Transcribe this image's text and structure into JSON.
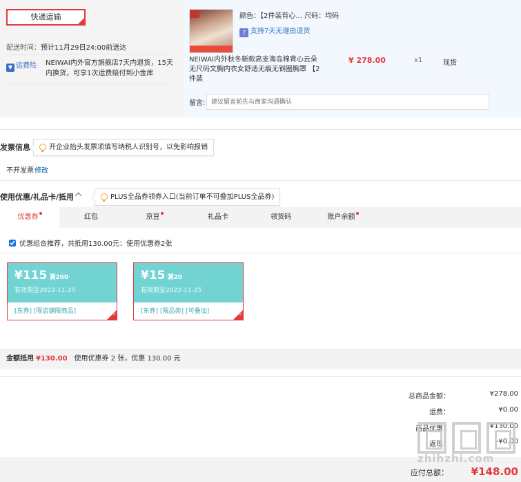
{
  "shipping": {
    "method_label": "快递运输",
    "time_label": "配送时间：",
    "time_value": "预计11月29日24:00前送达",
    "service_tag": "运费险",
    "service_text": "NEIWAI内外官方旗舰店7天内退货，15天内换货，可享1次运费赔付到小金库"
  },
  "product": {
    "attr_text": "颜色：【2件装背心...   尺码：均码",
    "return_text": "支持7天无理由退货",
    "return_icon": "seven-day-icon",
    "name": "NEIWAI内外秋冬新款高支海岛棉背心云朵无尺码文胸内衣女舒适无痕无钢圈胸罩 【2件装",
    "price": "¥ 278.00",
    "qty": "x1",
    "stock": "现货"
  },
  "remark": {
    "label": "留言:",
    "placeholder": "建议留言前先与商家沟通确认"
  },
  "invoice": {
    "title": "发票信息",
    "tip": "开企业抬头发票须填写纳税人识别号，以免影响报销",
    "status": "不开发票",
    "edit_label": "修改"
  },
  "coupons": {
    "title": "使用优惠/礼品卡/抵用",
    "tip": "PLUS全品券领券入口(当前订单不可叠加PLUS全品券)",
    "tabs": [
      {
        "label": "优惠券",
        "active": true
      },
      {
        "label": "红包"
      },
      {
        "label": "京豆"
      },
      {
        "label": "礼品卡"
      },
      {
        "label": "领货码"
      },
      {
        "label": "账户余额"
      }
    ],
    "combo_text": "优惠组合推荐，共抵用130.00元：使用优惠券2张",
    "items": [
      {
        "amount": "¥115",
        "condition": "满200",
        "valid": "有效期至2022-11-25",
        "tags": [
          "[东券]",
          "[限店铺限商品]"
        ]
      },
      {
        "amount": "¥15",
        "condition": "满20",
        "valid": "有效期至2022-11-25",
        "tags": [
          "[东券]",
          "[限品类]",
          "[可叠加]"
        ]
      }
    ],
    "summary_label": "金额抵用",
    "summary_amount": "¥130.00",
    "summary_text": "使用优惠券 2 张，优惠 130.00 元"
  },
  "totals": {
    "goods_label": "总商品金额：",
    "goods_value": "¥278.00",
    "freight_label": "运费：",
    "freight_value": "¥0.00",
    "discount_label": "商品优惠：",
    "discount_value": "-¥130.00",
    "return_freight_label": "返现：",
    "return_freight_value": "-¥0.00",
    "pay_label": "应付总额：",
    "pay_value": "¥148.00"
  },
  "watermark": {
    "text": "zhihzhi.com"
  },
  "colors": {
    "accent": "#e4393c",
    "coupon": "#72d3d3",
    "link": "#005ea7"
  }
}
